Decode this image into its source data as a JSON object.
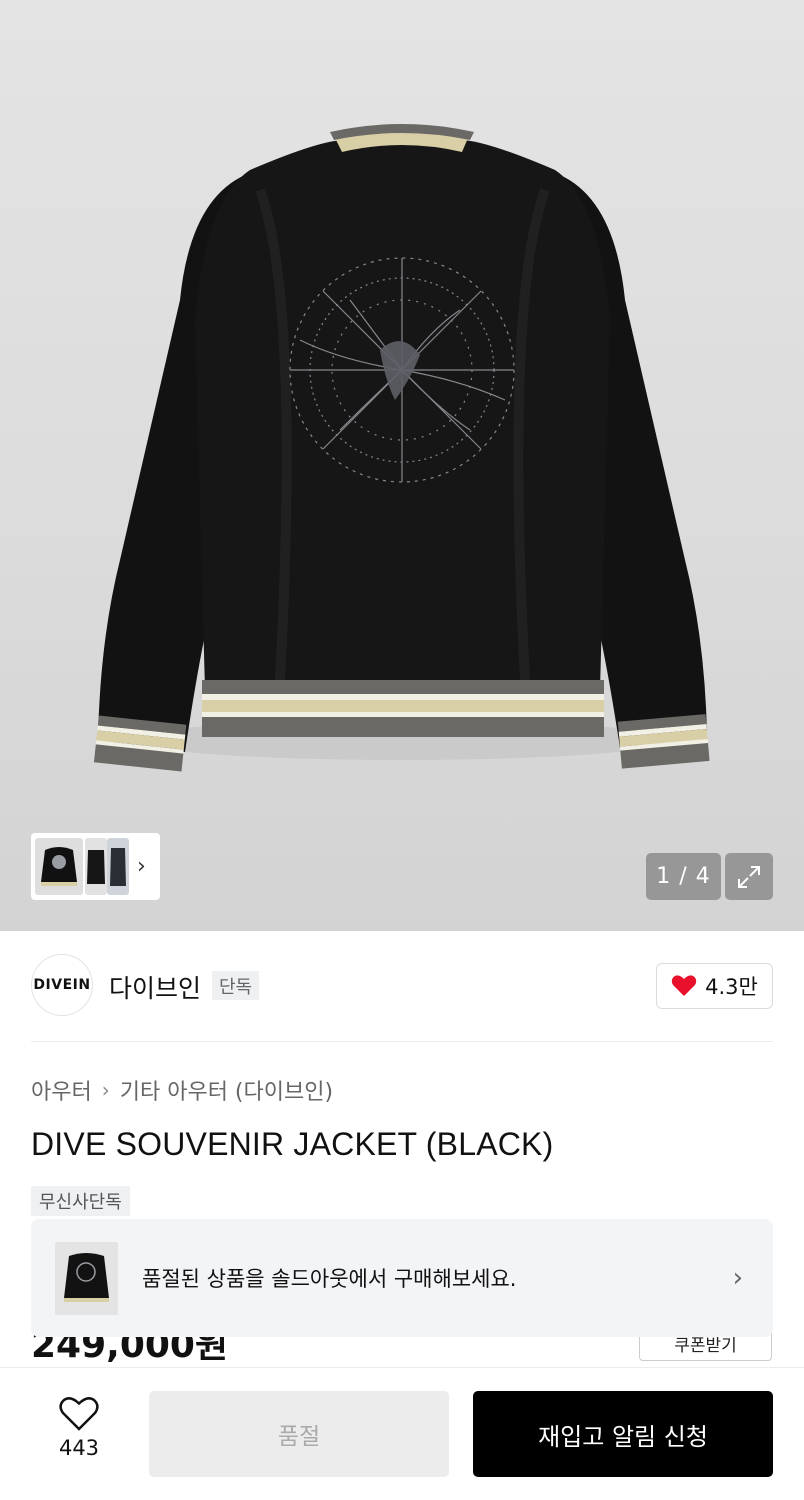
{
  "gallery": {
    "counter": "1 / 4",
    "expand_icon": "expand-icon",
    "next_icon": "chevron-right-icon"
  },
  "brand": {
    "logo_text": "DIVEIN",
    "name": "다이브인",
    "tag": "단독",
    "likes": "4.3만",
    "like_icon": "heart-filled-icon",
    "like_color": "#e8102b"
  },
  "product": {
    "breadcrumb": [
      "아우터",
      "기타 아우터 (다이브인)"
    ],
    "title": "DIVE SOUVENIR JACKET (BLACK)",
    "badge": "무신사단독",
    "price": "249,000원",
    "coupon_label": "쿠폰받기"
  },
  "soldout_banner": {
    "text": "품절된 상품을 솔드아웃에서 구매해보세요."
  },
  "bottom_bar": {
    "wish_count": "443",
    "soldout_label": "품절",
    "restock_label": "재입고 알림 신청"
  }
}
